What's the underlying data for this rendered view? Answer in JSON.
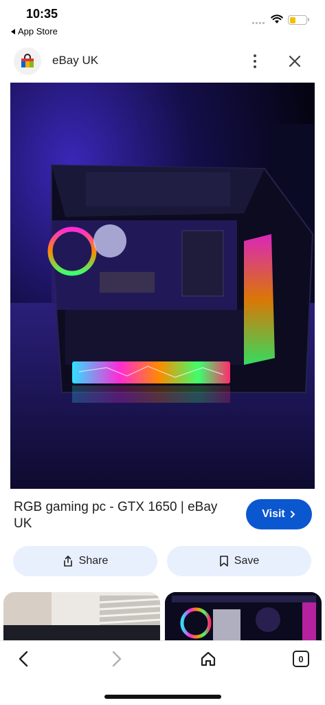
{
  "status_bar": {
    "time": "10:35",
    "back_app": "App Store",
    "icons": [
      "signal-icon",
      "wifi-icon",
      "battery-icon"
    ]
  },
  "header": {
    "site_icon": "ebay-bag-icon",
    "title": "eBay UK",
    "icons": [
      "more-vertical-icon",
      "close-icon"
    ]
  },
  "image": {
    "alt_subject": "gaming pc with rgb lighting",
    "colors": {
      "background": "#070616",
      "purple": "#4a2ec7",
      "cyan": "#2fe0ff",
      "magenta": "#ff2bd6",
      "orange": "#ff8a00",
      "green": "#3dff6c"
    }
  },
  "result": {
    "title": "RGB gaming pc - GTX 1650 | eBay UK",
    "visit_label": "Visit",
    "share_label": "Share",
    "save_label": "Save"
  },
  "bottom_nav": {
    "tabs_count": "0",
    "icons": [
      "back-arrow-icon",
      "forward-arrow-icon",
      "home-icon",
      "tabs-icon"
    ]
  },
  "colors": {
    "accent": "#0b57d0",
    "pill_bg": "#e8f0fe",
    "text": "#1f1f1f"
  }
}
